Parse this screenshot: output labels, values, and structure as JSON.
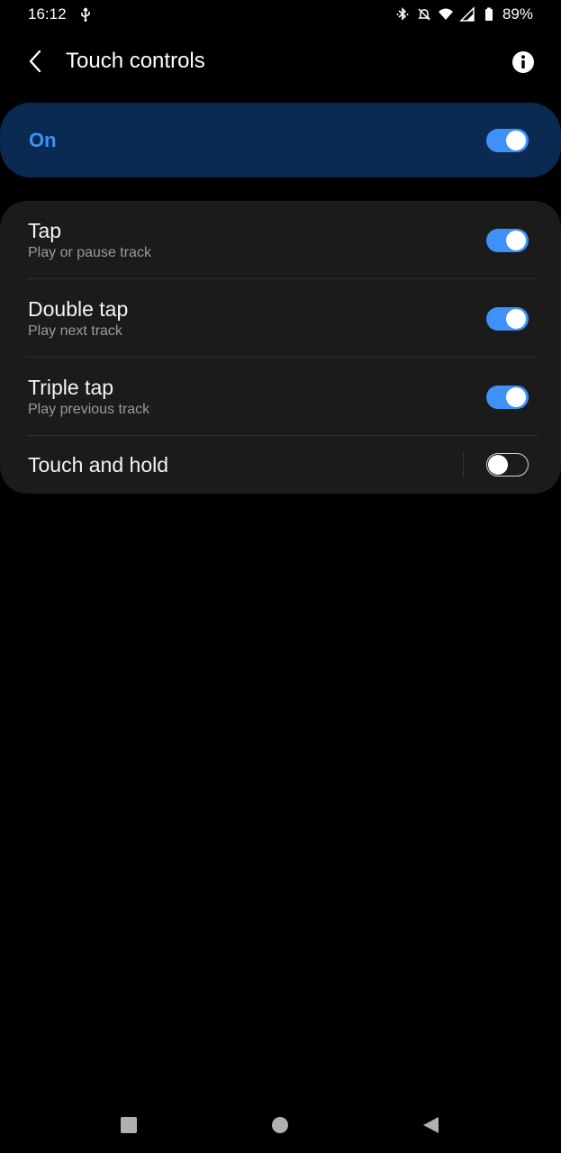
{
  "status_bar": {
    "time": "16:12",
    "battery_percent": "89%",
    "icons": [
      "usb-icon",
      "bluetooth-icon",
      "mute-icon",
      "wifi-icon",
      "signal-icon",
      "battery-icon"
    ]
  },
  "app_bar": {
    "title": "Touch controls",
    "back_icon": "chevron-left-icon",
    "info_icon": "info-icon"
  },
  "master_switch": {
    "label": "On",
    "checked": true
  },
  "settings": [
    {
      "title": "Tap",
      "subtitle": "Play or pause track",
      "checked": true
    },
    {
      "title": "Double tap",
      "subtitle": "Play next track",
      "checked": true
    },
    {
      "title": "Triple tap",
      "subtitle": "Play previous track",
      "checked": true
    },
    {
      "title": "Touch and hold",
      "subtitle": "",
      "checked": false
    }
  ],
  "nav_bar": {
    "icons": [
      "recent-apps-icon",
      "home-icon",
      "back-triangle-icon"
    ]
  },
  "colors": {
    "accent": "#3e91f6",
    "master_card_bg": "#0b2a52",
    "list_card_bg": "#1b1b1b",
    "background": "#000000"
  }
}
